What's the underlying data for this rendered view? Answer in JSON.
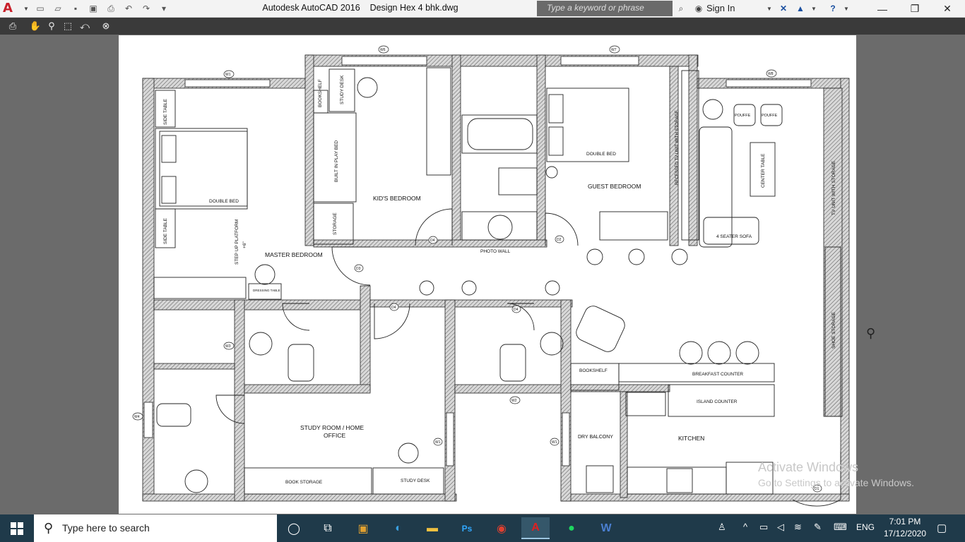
{
  "titlebar": {
    "app_title": "Autodesk AutoCAD 2016",
    "file_name": "Design Hex 4 bhk.dwg",
    "search_placeholder": "Type a keyword or phrase",
    "sign_in": "Sign In"
  },
  "plan": {
    "rooms": {
      "kids_bedroom": "KID'S BEDROOM",
      "guest_bedroom": "GUEST BEDROOM",
      "master_bedroom": "MASTER BEDROOM",
      "study_room_line1": "STUDY ROOM / HOME",
      "study_room_line2": "OFFICE",
      "kitchen": "KITCHEN",
      "dry_balcony": "DRY BALCONY"
    },
    "furniture": {
      "photo_wall": "PHOTO WALL",
      "double_bed": "DOUBLE BED",
      "double_bed_guest": "DOUBLE BED",
      "bookshelf_kid": "BOOKSHELF",
      "study_desk_kid": "STUDY DESK",
      "built_in_play_bed": "BUILT IN PLAY BED",
      "storage_kid": "STORAGE",
      "side_table_1": "SIDE TABLE",
      "side_table_2": "SIDE TABLE",
      "step_up_platform": "STEP UP PLATFORM",
      "step_up_height": "+6\"",
      "dressing_table": "DRESSING TABLE",
      "recessed_tv": "RECESSED TV UNIT WITH STORAGE",
      "pouffe_1": "POUFFE",
      "pouffe_2": "POUFFE",
      "center_table": "CENTER TABLE",
      "sofa": "4 SEATER SOFA",
      "tv_unit": "TV UNIT WITH STORAGE",
      "shoe_storage": "SHOE STORAGE",
      "breakfast_counter": "BREAKFAST COUNTER",
      "island_counter": "ISLAND COUNTER",
      "bookshelf_living": "BOOKSHELF",
      "book_storage": "BOOK STORAGE",
      "study_desk": "STUDY DESK"
    },
    "tags": {
      "w1": "W1",
      "w2": "W2",
      "w3": "W3",
      "w4": "W4",
      "w6": "W6",
      "w7": "W7",
      "w8": "W8",
      "w_study": "W1",
      "w_kitchen": "W1",
      "d1": "D1",
      "d2": "D2",
      "d3": "D3",
      "d4": "D4",
      "d4b": "D4",
      "d4c": "D4",
      "d4d": "D4"
    }
  },
  "watermark": {
    "line1": "Activate Windows",
    "line2": "Go to Settings to activate Windows."
  },
  "taskbar": {
    "search_placeholder": "Type here to search",
    "language": "ENG",
    "time": "7:01 PM",
    "date": "17/12/2020"
  },
  "colors": {
    "accent_red": "#c8202a",
    "wall_fill": "#b5b5b5",
    "taskbar": "#1f3a4a"
  }
}
